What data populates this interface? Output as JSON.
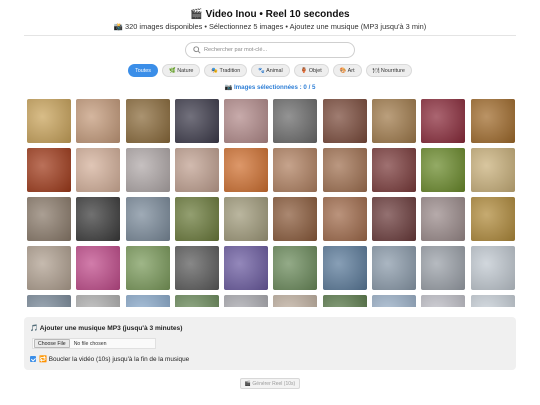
{
  "header": {
    "title": "🎬 Video Inou • Reel 10 secondes",
    "subtitle": "📸 320 images disponibles • Sélectionnez 5 images • Ajoutez une musique (MP3 jusqu'à 3 min)"
  },
  "search": {
    "placeholder": "Rechercher par mot-clé...",
    "value": "",
    "icon": "search-icon"
  },
  "filters": [
    {
      "label": "Toutes",
      "active": true,
      "icon": ""
    },
    {
      "label": "🌿 Nature",
      "active": false,
      "icon": ""
    },
    {
      "label": "🎭 Tradition",
      "active": false,
      "icon": ""
    },
    {
      "label": "🐾 Animal",
      "active": false,
      "icon": ""
    },
    {
      "label": "🏺 Objet",
      "active": false,
      "icon": ""
    },
    {
      "label": "🎨 Art",
      "active": false,
      "icon": ""
    },
    {
      "label": "🍽 Nourriture",
      "active": false,
      "icon": ""
    }
  ],
  "selection": {
    "label": "📷 Images sélectionnées : 0 / 5"
  },
  "gallery": {
    "thumb_colors": [
      "#c9a35a",
      "#c49a7a",
      "#8a6a3a",
      "#3c3a4a",
      "#b28a8a",
      "#6a6a6a",
      "#7a4a3a",
      "#a07a4a",
      "#8a2a3a",
      "#a06a2a",
      "#a03a1a",
      "#d4b09a",
      "#b0a8a8",
      "#c0a090",
      "#d07030",
      "#b08060",
      "#a07050",
      "#7a3a3a",
      "#6a8a2a",
      "#c9b07a",
      "#8a7a6a",
      "#3a3a3a",
      "#7a8a9a",
      "#6a7a3a",
      "#a09a7a",
      "#8a5a3a",
      "#a06a4a",
      "#6a3a3a",
      "#9a8a8a",
      "#b08a3a",
      "#b0a090",
      "#c04a8a",
      "#7a9a5a",
      "#5a5a5a",
      "#6a5aa0",
      "#6a8a5a",
      "#5a7a9a",
      "#8a9aaa",
      "#9aa0a8",
      "#c0c8d0",
      "#7a8a9a",
      "#b0b0b0",
      "#8aaacc",
      "#6a8a5a",
      "#aaaab0",
      "#c0b0a0",
      "#5a7a4a",
      "#9ab0c8",
      "#c0c0c8",
      "#c8d0d8"
    ]
  },
  "music": {
    "title": "🎵 Ajouter une musique MP3 (jusqu'à 3 minutes)",
    "file_button": "Choose File",
    "file_status": "No file chosen",
    "loop_label": "🔁 Boucler la vidéo (10s) jusqu'à la fin de la musique",
    "loop_checked": true
  },
  "actions": {
    "generate_label": "🎬 Générer Reel (10s)",
    "generate_enabled": false
  },
  "colors": {
    "accent": "#3b8ee8",
    "selection_text": "#2f7fd6"
  }
}
